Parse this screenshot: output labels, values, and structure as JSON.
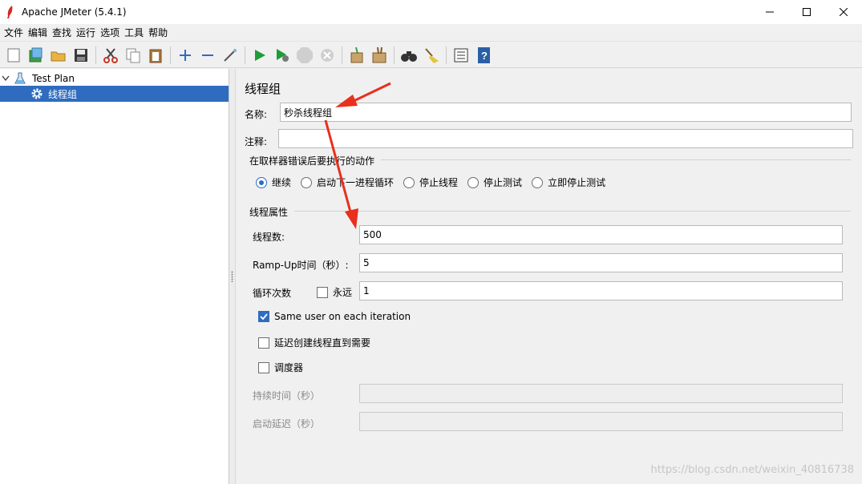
{
  "window": {
    "title": "Apache JMeter (5.4.1)"
  },
  "menu": [
    "文件",
    "编辑",
    "查找",
    "运行",
    "选项",
    "工具",
    "帮助"
  ],
  "tree": {
    "root": "Test Plan",
    "child": "线程组"
  },
  "panel": {
    "title": "线程组",
    "name_label": "名称:",
    "name_value": "秒杀线程组",
    "comment_label": "注释:",
    "comment_value": "",
    "error_action": {
      "title": "在取样器错误后要执行的动作",
      "options": [
        "继续",
        "启动下一进程循环",
        "停止线程",
        "停止测试",
        "立即停止测试"
      ],
      "selected": "继续"
    },
    "thread_props": {
      "title": "线程属性",
      "threads_label": "线程数:",
      "threads_value": "500",
      "rampup_label": "Ramp-Up时间（秒）:",
      "rampup_value": "5",
      "loop_label": "循环次数",
      "forever_label": "永远",
      "loop_value": "1",
      "same_user_label": "Same user on each iteration",
      "delay_label": "延迟创建线程直到需要",
      "scheduler_label": "调度器",
      "duration_label": "持续时间（秒）",
      "startup_delay_label": "启动延迟（秒）"
    }
  },
  "watermark": "https://blog.csdn.net/weixin_40816738",
  "colors": {
    "selection": "#2f6cc0",
    "annotation_arrow": "#e8301c"
  }
}
